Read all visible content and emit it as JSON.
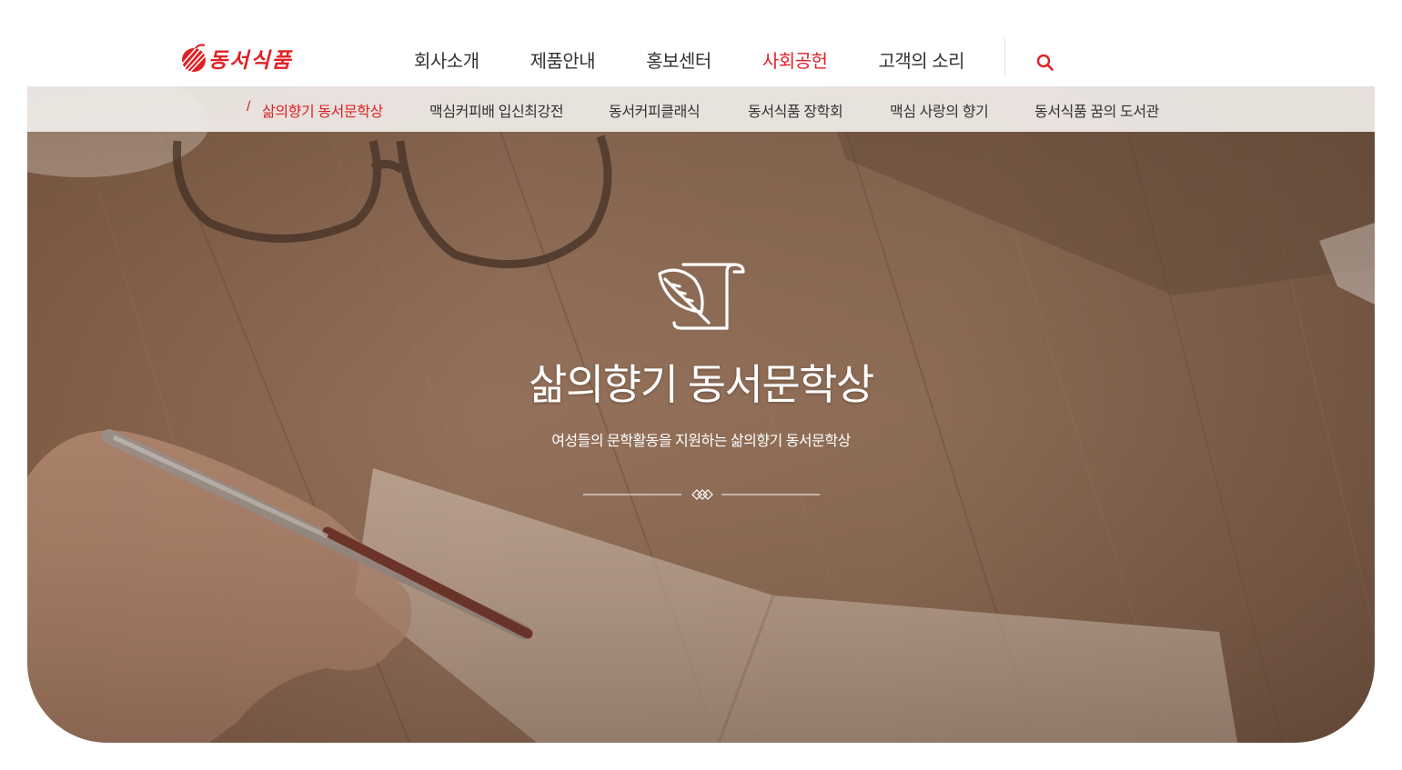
{
  "header": {
    "logo_text": "동서식품",
    "nav": [
      {
        "label": "회사소개",
        "active": false
      },
      {
        "label": "제품안내",
        "active": false
      },
      {
        "label": "홍보센터",
        "active": false
      },
      {
        "label": "사회공헌",
        "active": true
      },
      {
        "label": "고객의 소리",
        "active": false
      }
    ],
    "search_icon": "search-icon"
  },
  "subnav": {
    "items": [
      {
        "label": "삶의향기 동서문학상",
        "active": true
      },
      {
        "label": "맥심커피배 입신최강전",
        "active": false
      },
      {
        "label": "동서커피클래식",
        "active": false
      },
      {
        "label": "동서식품 장학회",
        "active": false
      },
      {
        "label": "맥심 사랑의 향기",
        "active": false
      },
      {
        "label": "동서식품 꿈의 도서관",
        "active": false
      }
    ]
  },
  "hero": {
    "icon": "quill-scroll-icon",
    "title": "삶의향기 동서문학상",
    "subtitle": "여성들의 문학활동을 지원하는 삶의향기 동서문학상",
    "ornament": "diamond-divider"
  },
  "colors": {
    "accent": "#e02126",
    "text": "#333333",
    "subnav_bg": "#f0ece8",
    "hero_overlay": "#8d6c55"
  }
}
